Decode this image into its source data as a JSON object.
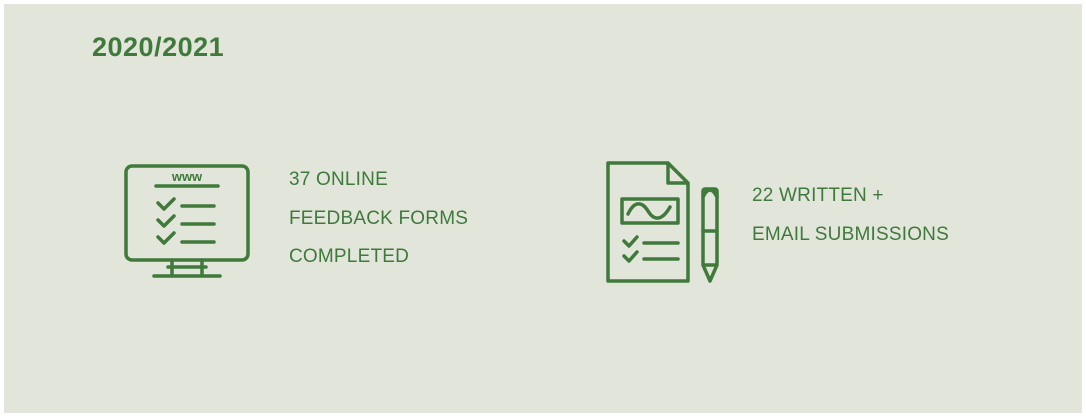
{
  "heading": {
    "year": "2020/2021"
  },
  "stats": [
    {
      "icon": "monitor-checklist-icon",
      "icon_label": "www",
      "lines": [
        "37 ONLINE",
        "FEEDBACK FORMS",
        "COMPLETED"
      ]
    },
    {
      "icon": "document-pencil-icon",
      "lines": [
        "22 WRITTEN +",
        "EMAIL SUBMISSIONS"
      ]
    }
  ],
  "colors": {
    "background": "#e1e5da",
    "accent": "#3f7a3b"
  }
}
